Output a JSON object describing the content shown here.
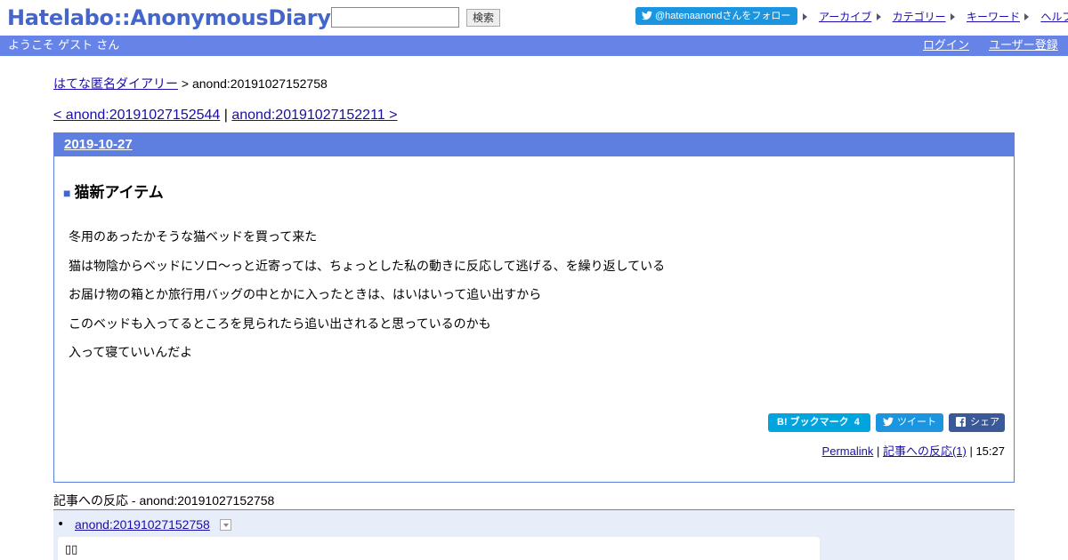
{
  "header": {
    "logo": "Hatelabo::AnonymousDiary",
    "search_placeholder": "",
    "search_button": "検索",
    "follow_button": "@hatenaanondさんをフォロー",
    "nav": [
      "アーカイブ",
      "カテゴリー",
      "キーワード",
      "ヘルプ"
    ]
  },
  "userbar": {
    "welcome": "ようこそ ゲスト さん",
    "login": "ログイン",
    "register": "ユーザー登録"
  },
  "breadcrumb": {
    "home": "はてな匿名ダイアリー",
    "sep": " > ",
    "current": "anond:20191027152758"
  },
  "pager": {
    "prev": "< anond:20191027152544",
    "sep": " | ",
    "next": "anond:20191027152211 >"
  },
  "entry": {
    "date": "2019-10-27",
    "title_mark": "■",
    "title": "猫新アイテム",
    "paragraphs": [
      "冬用のあったかそうな猫ベッドを買って来た",
      "猫は物陰からベッドにソロ～っと近寄っては、ちょっとした私の動きに反応して逃げる、を繰り返している",
      "お届け物の箱とか旅行用バッグの中とかに入ったときは、はいはいって追い出すから",
      "このベッドも入ってるところを見られたら追い出されると思っているのかも",
      "入って寝ていいんだよ"
    ],
    "share": {
      "bookmark": "B! ブックマーク  4",
      "tweet": "ツイート",
      "facebook": "シェア"
    },
    "footer": {
      "permalink": "Permalink",
      "sep1": " | ",
      "reactions": "記事への反応(1)",
      "sep2": " | ",
      "time": "15:27"
    }
  },
  "reactions": {
    "title": "記事への反応 - anond:20191027152758",
    "items": [
      {
        "bullet": "•",
        "link": "anond:20191027152758",
        "body": "▯▯"
      }
    ]
  },
  "colors": {
    "accent": "#5f7fe0",
    "logo": "#4466cc",
    "twitter": "#1b95e0",
    "hatena_bookmark": "#00a4de",
    "facebook": "#3b5998"
  }
}
